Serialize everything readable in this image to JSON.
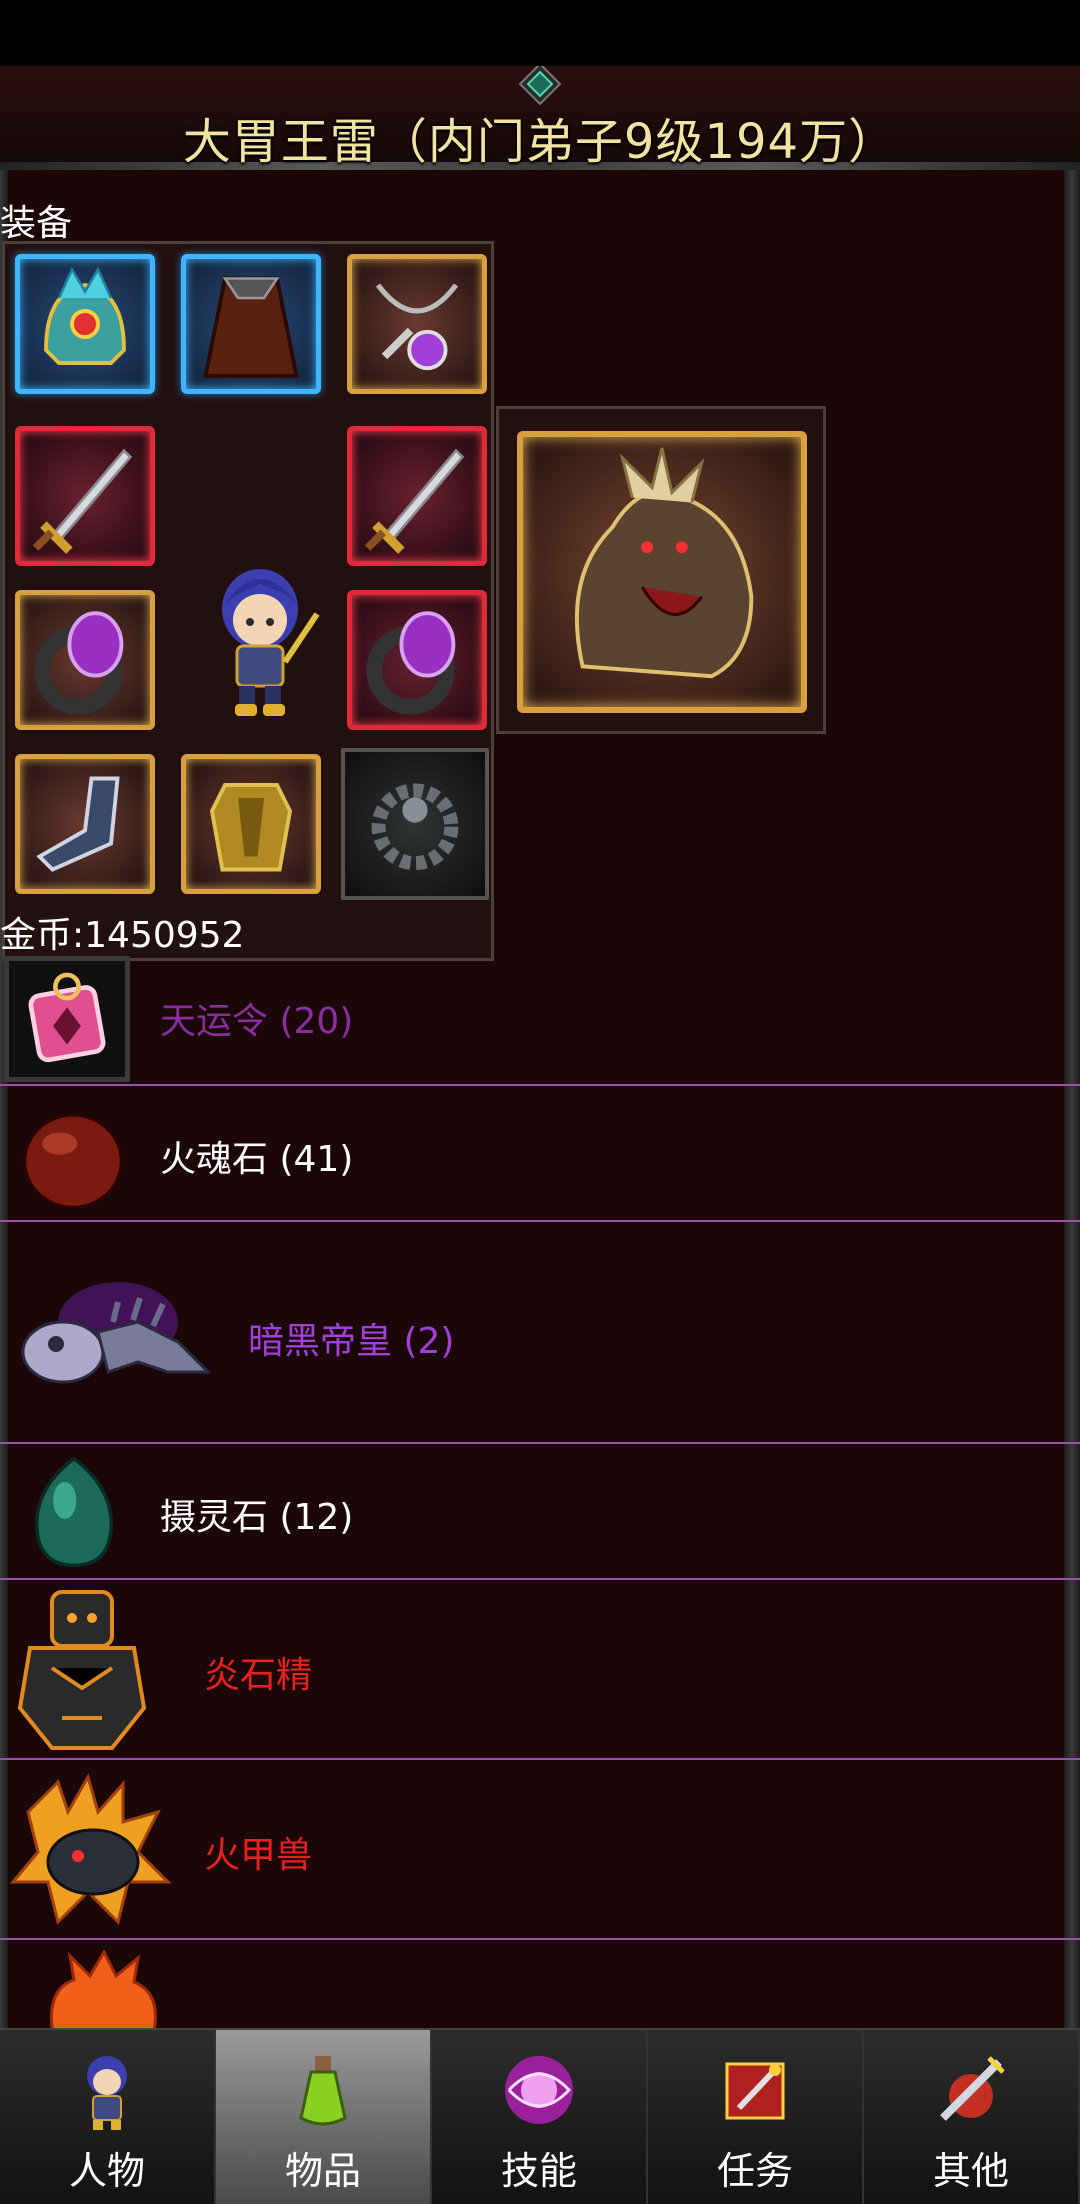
{
  "title": "大胃王雷（内门弟子9级194万）",
  "equipment_label": "装备",
  "gold_label": "金币:1450952",
  "items": [
    {
      "label": "天运令 (20)",
      "color": "#8a2e9e",
      "icon": "talisman-icon"
    },
    {
      "label": "火魂石 (41)",
      "color": "#ffffff",
      "icon": "red-stone-icon"
    },
    {
      "label": "暗黑帝皇 (2)",
      "color": "#a040d8",
      "icon": "dark-beast-icon"
    },
    {
      "label": "摄灵石 (12)",
      "color": "#ffffff",
      "icon": "green-stone-icon"
    },
    {
      "label": "炎石精",
      "color": "#e82020",
      "icon": "rock-golem-icon"
    },
    {
      "label": "火甲兽",
      "color": "#e82020",
      "icon": "fire-dragon-icon"
    }
  ],
  "tabs": [
    {
      "label": "人物",
      "icon": "character-icon",
      "active": false
    },
    {
      "label": "物品",
      "icon": "potion-icon",
      "active": true
    },
    {
      "label": "技能",
      "icon": "skill-orb-icon",
      "active": false
    },
    {
      "label": "任务",
      "icon": "quest-icon",
      "active": false
    },
    {
      "label": "其他",
      "icon": "other-icon",
      "active": false
    }
  ],
  "colors": {
    "background": "#1c0708",
    "divider": "#9a4fb0",
    "title": "#f3e3a0",
    "rare_purple": "#a040d8",
    "epic_red": "#e82020"
  }
}
